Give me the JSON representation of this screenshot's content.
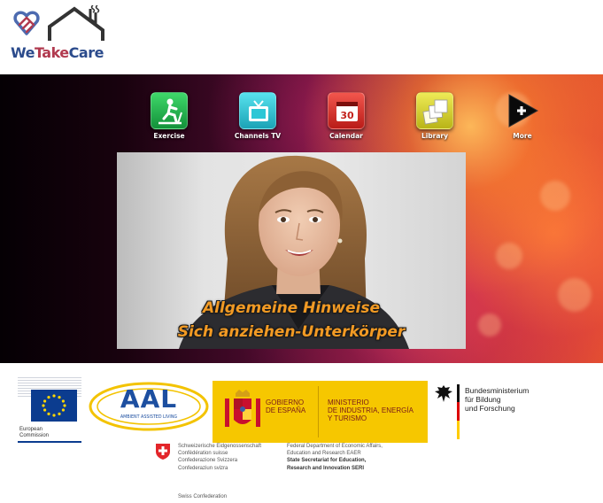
{
  "brand": {
    "name_we": "We",
    "name_take": "Take",
    "name_care": "Care"
  },
  "nav": {
    "items": [
      {
        "label": "Exercise",
        "color": "#22b24c"
      },
      {
        "label": "Channels TV",
        "color": "#2cc7d6"
      },
      {
        "label": "Calendar",
        "color": "#e3342c",
        "badge": "30"
      },
      {
        "label": "Library",
        "color": "#d8d22a"
      },
      {
        "label": "More",
        "color": "#111111"
      }
    ]
  },
  "video": {
    "caption_line1": "Allgemeine Hinweise",
    "caption_line2": "Sich anziehen-Unterkörper"
  },
  "sponsors": {
    "ec": {
      "line1": "European",
      "line2": "Commission"
    },
    "aal": {
      "title": "AAL",
      "subtitle": "AMBIENT ASSISTED LIVING"
    },
    "spain": {
      "gov_line1": "GOBIERNO",
      "gov_line2": "DE ESPAÑA",
      "min_line1": "MINISTERIO",
      "min_line2": "DE INDUSTRIA, ENERGÍA",
      "min_line3": "Y TURISMO"
    },
    "bmbf": {
      "line1": "Bundesministerium",
      "line2": "für Bildung",
      "line3": "und Forschung"
    },
    "swiss": {
      "names": [
        "Schweizerische Eidgenossenschaft",
        "Confédération suisse",
        "Confederazione Svizzera",
        "Confederaziun svizra"
      ],
      "dept_line1": "Federal Department of Economic Affairs,",
      "dept_line2": "Education and Research EAER",
      "seri_line1": "State Secretariat for Education,",
      "seri_line2": "Research and Innovation SERI",
      "footer": "Swiss Confederation"
    }
  },
  "colors": {
    "eu_blue": "#0b3c8f",
    "spain_yellow": "#f6c700",
    "aal_blue": "#1d4fa0",
    "swiss_red": "#e3252a"
  }
}
